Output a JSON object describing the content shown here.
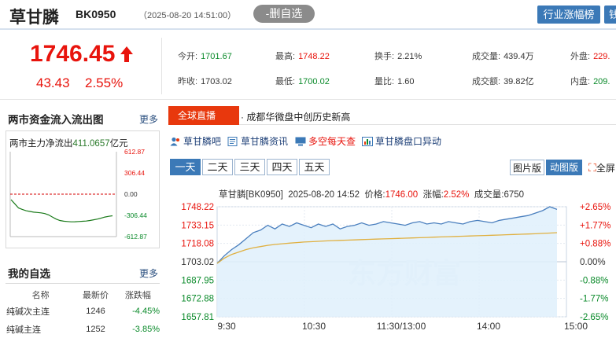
{
  "header": {
    "name": "草甘膦",
    "code": "BK0950",
    "time": "（2025-08-20 14:51:00）",
    "fav_button": "-删自选",
    "industry_button": "行业涨幅榜",
    "cut_button": "钱"
  },
  "quote": {
    "price": "1746.45",
    "change": "43.43",
    "change_pct": "2.55%",
    "fields": {
      "open_label": "今开:",
      "open": "1701.67",
      "high_label": "最高:",
      "high": "1748.22",
      "turnover_label": "换手:",
      "turnover": "2.21%",
      "volume_label": "成交量:",
      "volume": "439.4万",
      "outer_label": "外盘:",
      "outer": "229.",
      "prev_label": "昨收:",
      "prev": "1703.02",
      "low_label": "最低:",
      "low": "1700.02",
      "ratio_label": "量比:",
      "ratio": "1.60",
      "amount_label": "成交额:",
      "amount": "39.82亿",
      "inner_label": "内盘:",
      "inner": "209."
    }
  },
  "fund_flow": {
    "title": "两市资金流入流出图",
    "more": "更多",
    "label": "两市主力净流出",
    "value": "411.0657",
    "unit": "亿元",
    "ticks": [
      "612.87",
      "306.44",
      "0.00",
      "-306.44",
      "-612.87"
    ]
  },
  "watchlist": {
    "title": "我的自选",
    "more": "更多",
    "headers": [
      "名称",
      "最新价",
      "涨跌幅"
    ],
    "rows": [
      {
        "name": "纯碱次主连",
        "price": "1246",
        "pct": "-4.45%"
      },
      {
        "name": "纯碱主连",
        "price": "1252",
        "pct": "-3.85%"
      }
    ]
  },
  "news_bar": {
    "tab": "全球直播",
    "headline": "· 成都华微盘中创历史新高"
  },
  "links": [
    {
      "label": "草甘膦吧",
      "icon": "people-icon"
    },
    {
      "label": "草甘膦资讯",
      "icon": "news-icon"
    },
    {
      "label": "多空每天查",
      "icon": "monitor-icon"
    },
    {
      "label": "草甘膦盘口异动",
      "icon": "chart-icon"
    }
  ],
  "period_tabs": [
    "一天",
    "二天",
    "三天",
    "四天",
    "五天"
  ],
  "view_buttons": {
    "image": "图片版",
    "dynamic": "动图版",
    "full": "全屏"
  },
  "chart_info": {
    "name": "草甘膦[BK0950]",
    "time": "2025-08-20 14:52",
    "price_label": "价格:",
    "price": "1746.00",
    "pct_label": "涨幅:",
    "pct": "2.52%",
    "vol_label": "成交量:",
    "vol": "6750",
    "watermark": "东方财富"
  },
  "chart_data": {
    "type": "line",
    "x_ticks": [
      "9:30",
      "10:30",
      "11:30/13:00",
      "14:00",
      "15:00"
    ],
    "y_ticks_left": [
      "1748.22",
      "1733.15",
      "1718.08",
      "1703.02",
      "1687.95",
      "1672.88",
      "1657.81"
    ],
    "y_ticks_right": [
      "+2.65%",
      "+1.77%",
      "+0.88%",
      "0.00%",
      "-0.88%",
      "-1.77%",
      "-2.65%"
    ],
    "ylim": [
      1657.81,
      1748.22
    ],
    "prev_close": 1703.02,
    "colors": {
      "price": "#4a7fbe",
      "avg": "#e0b040",
      "fill": "#dff0fb"
    },
    "series": [
      {
        "values": [
          1701.67,
          1708,
          1713,
          1717,
          1722,
          1727,
          1729,
          1733,
          1730,
          1734,
          1732,
          1735,
          1733,
          1731,
          1734,
          1732,
          1734,
          1730,
          1732,
          1733,
          1735,
          1733,
          1734,
          1736,
          1735,
          1734,
          1733,
          1735,
          1736,
          1734,
          1735,
          1734,
          1736,
          1735,
          1734,
          1736,
          1737,
          1736,
          1735,
          1737,
          1738,
          1739,
          1740,
          1741,
          1743,
          1745,
          1748.22,
          1746
        ]
      },
      {
        "values": [
          1701.67,
          1706,
          1709,
          1711,
          1713,
          1714.5,
          1715.5,
          1716.5,
          1717.2,
          1717.8,
          1718.3,
          1718.8,
          1719.2,
          1719.5,
          1719.8,
          1720.1,
          1720.4,
          1720.6,
          1720.8,
          1721,
          1721.2,
          1721.4,
          1721.6,
          1721.8,
          1722,
          1722.2,
          1722.4,
          1722.6,
          1722.8,
          1723,
          1723.2,
          1723.4,
          1723.6,
          1723.8,
          1724,
          1724.2,
          1724.4,
          1724.6,
          1724.8,
          1725,
          1725.2,
          1725.4,
          1725.6,
          1725.8,
          1726,
          1726.3,
          1726.6,
          1726.9
        ]
      }
    ]
  },
  "fund_chart_data": {
    "type": "line",
    "ylim": [
      -612.87,
      612.87
    ],
    "values": [
      -80,
      -140,
      -200,
      -220,
      -240,
      -250,
      -260,
      -265,
      -270,
      -280,
      -300,
      -330,
      -360,
      -380,
      -390,
      -395,
      -400,
      -398,
      -395,
      -392,
      -388,
      -380,
      -370,
      -360,
      -345,
      -330,
      -320,
      -312
    ]
  }
}
